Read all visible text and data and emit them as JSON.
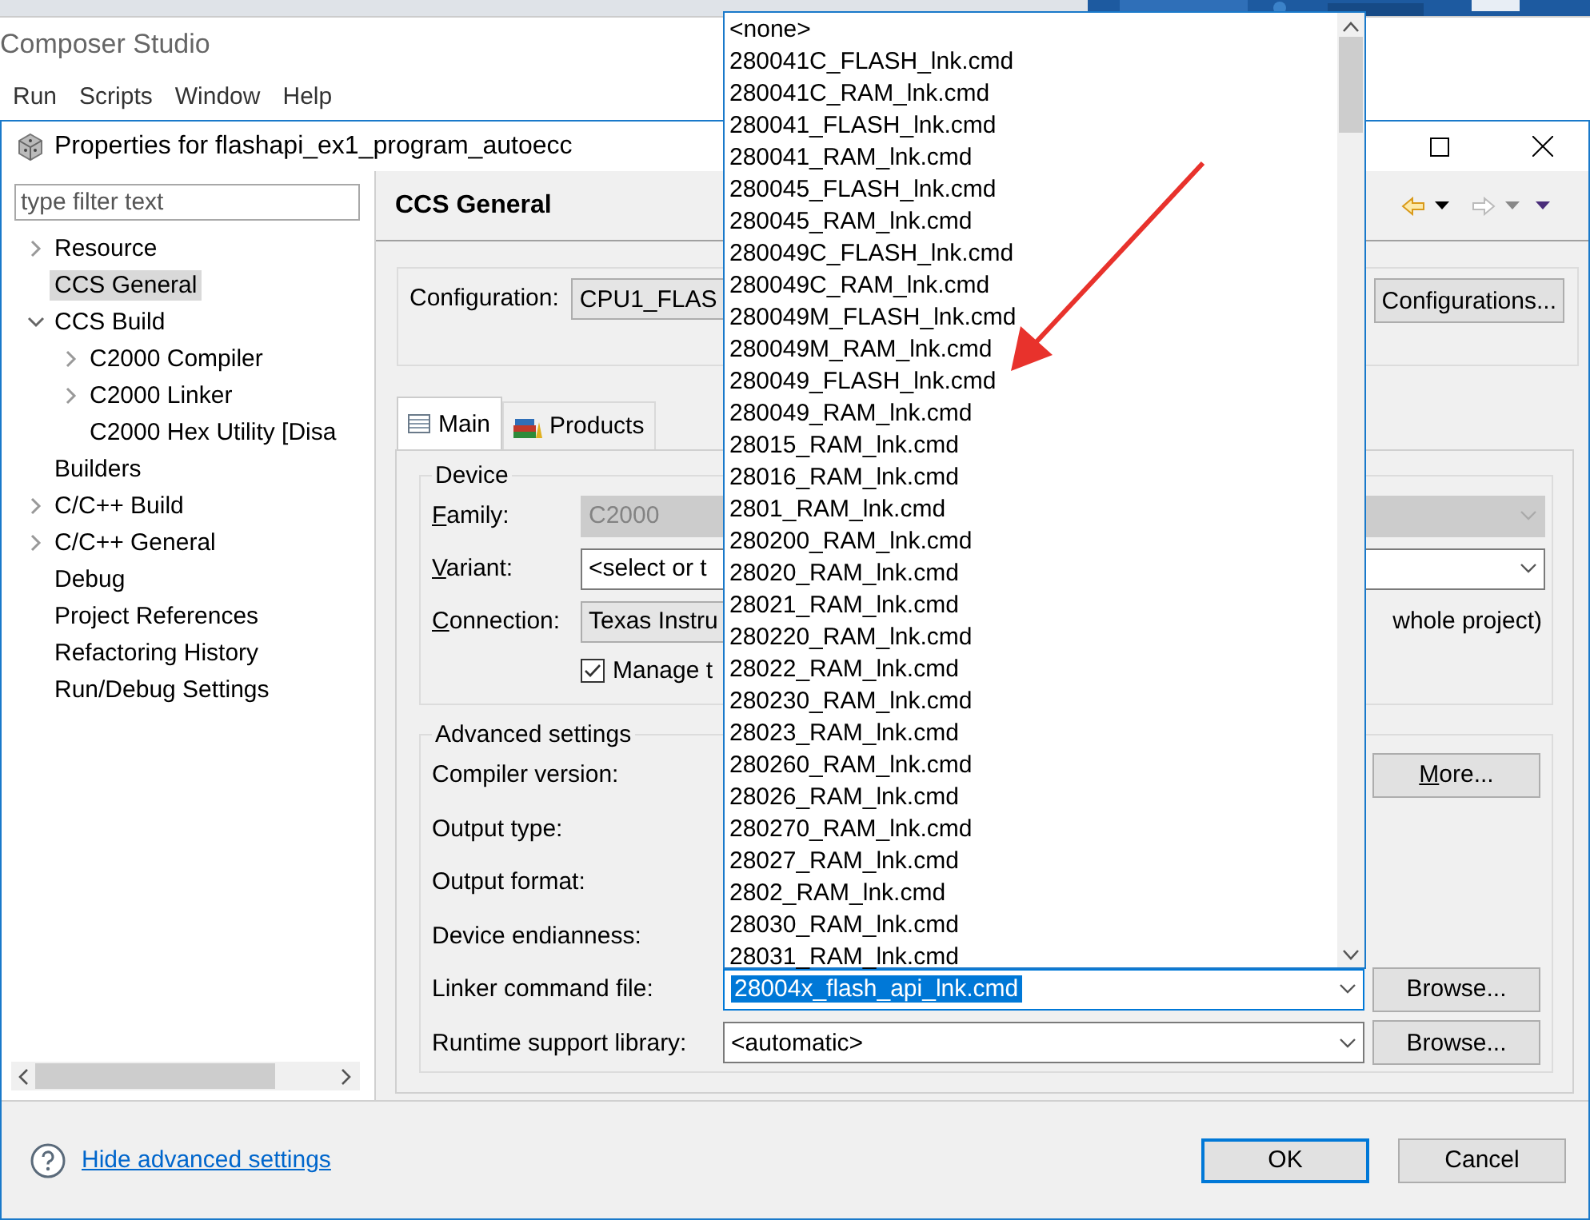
{
  "app_window": {
    "title": "Composer Studio",
    "menu": [
      "Run",
      "Scripts",
      "Window",
      "Help"
    ]
  },
  "dialog": {
    "title": "Properties for flashapi_ex1_program_autoecc"
  },
  "filter": {
    "placeholder": "type filter text"
  },
  "tree": [
    {
      "label": "Resource",
      "selected": false,
      "expanded": false
    },
    {
      "label": "CCS General",
      "selected": true
    },
    {
      "label": "CCS Build",
      "selected": false,
      "expanded": true,
      "children": [
        {
          "label": "C2000 Compiler",
          "selected": false,
          "expanded": false
        },
        {
          "label": "C2000 Linker",
          "selected": false,
          "expanded": false
        },
        {
          "label": "C2000 Hex Utility  [Disa",
          "selected": false
        }
      ]
    },
    {
      "label": "Builders",
      "selected": false
    },
    {
      "label": "C/C++ Build",
      "selected": false,
      "expanded": false
    },
    {
      "label": "C/C++ General",
      "selected": false,
      "expanded": false
    },
    {
      "label": "Debug",
      "selected": false
    },
    {
      "label": "Project References",
      "selected": false
    },
    {
      "label": "Refactoring History",
      "selected": false
    },
    {
      "label": "Run/Debug Settings",
      "selected": false
    }
  ],
  "page": {
    "title": "CCS General"
  },
  "configuration": {
    "label": "Configuration:",
    "value": "CPU1_FLAS",
    "button": "Configurations..."
  },
  "tabs": [
    {
      "label": "Main",
      "selected": true
    },
    {
      "label": "Products",
      "selected": false
    }
  ],
  "device": {
    "legend": "Device",
    "fields": [
      {
        "label": "Family:",
        "value": "C2000",
        "disabled": true
      },
      {
        "label": "Variant:",
        "value": "<select or t",
        "disabled": false
      },
      {
        "label": "Connection:",
        "value": "Texas Instru",
        "disabled": false,
        "note": "whole project)"
      }
    ],
    "manage": {
      "label": "Manage t",
      "checked": true
    }
  },
  "advanced": {
    "legend": "Advanced settings",
    "rows": [
      {
        "kind": "button",
        "label": "Compiler version:",
        "button": "More..."
      },
      {
        "kind": "plain",
        "label": "Output type:"
      },
      {
        "kind": "plain",
        "label": "Output format:"
      },
      {
        "kind": "plain",
        "label": "Device endianness:"
      },
      {
        "kind": "combo",
        "label": "Linker command file:",
        "value": "28004x_flash_api_lnk.cmd",
        "focused": true,
        "button": "Browse..."
      },
      {
        "kind": "combo",
        "label": "Runtime support library:",
        "value": "<automatic>",
        "focused": false,
        "button": "Browse..."
      }
    ]
  },
  "dropdown": {
    "items": [
      "<none>",
      "280041C_FLASH_lnk.cmd",
      "280041C_RAM_lnk.cmd",
      "280041_FLASH_lnk.cmd",
      "280041_RAM_lnk.cmd",
      "280045_FLASH_lnk.cmd",
      "280045_RAM_lnk.cmd",
      "280049C_FLASH_lnk.cmd",
      "280049C_RAM_lnk.cmd",
      "280049M_FLASH_lnk.cmd",
      "280049M_RAM_lnk.cmd",
      "280049_FLASH_lnk.cmd",
      "280049_RAM_lnk.cmd",
      "28015_RAM_lnk.cmd",
      "28016_RAM_lnk.cmd",
      "2801_RAM_lnk.cmd",
      "280200_RAM_lnk.cmd",
      "28020_RAM_lnk.cmd",
      "28021_RAM_lnk.cmd",
      "280220_RAM_lnk.cmd",
      "28022_RAM_lnk.cmd",
      "280230_RAM_lnk.cmd",
      "28023_RAM_lnk.cmd",
      "280260_RAM_lnk.cmd",
      "28026_RAM_lnk.cmd",
      "280270_RAM_lnk.cmd",
      "28027_RAM_lnk.cmd",
      "2802_RAM_lnk.cmd",
      "28030_RAM_lnk.cmd",
      "28031_RAM_lnk.cmd"
    ]
  },
  "footer": {
    "link": "Hide advanced settings",
    "buttons": [
      {
        "label": "OK",
        "default": true
      },
      {
        "label": "Cancel",
        "default": false
      }
    ]
  }
}
